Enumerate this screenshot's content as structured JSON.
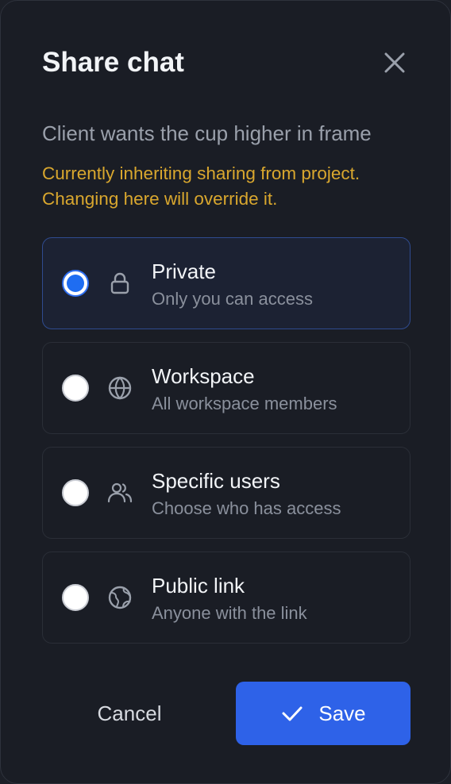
{
  "dialog": {
    "title": "Share chat",
    "close_icon": "close-icon",
    "chat_name": "Client wants the cup higher in frame",
    "warning_line1": "Currently inheriting sharing from project.",
    "warning_line2": "Changing here will override it.",
    "warning_color": "#d9a72e",
    "accent_color": "#2e62e8"
  },
  "options": [
    {
      "title": "Private",
      "subtitle": "Only you can access",
      "icon": "lock-icon",
      "selected": true
    },
    {
      "title": "Workspace",
      "subtitle": "All workspace members",
      "icon": "globe-icon",
      "selected": false
    },
    {
      "title": "Specific users",
      "subtitle": "Choose who has access",
      "icon": "users-icon",
      "selected": false
    },
    {
      "title": "Public link",
      "subtitle": "Anyone with the link",
      "icon": "world-icon",
      "selected": false
    }
  ],
  "footer": {
    "cancel_label": "Cancel",
    "save_label": "Save",
    "save_icon": "check-icon"
  }
}
